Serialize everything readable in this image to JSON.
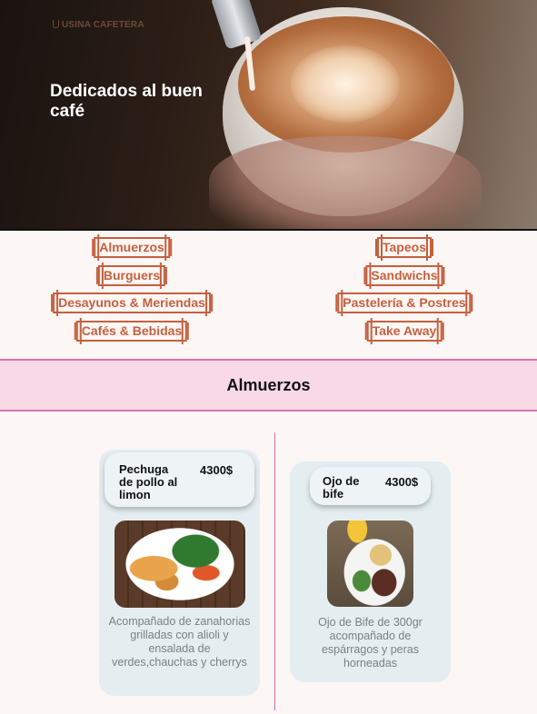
{
  "brand": {
    "logo_text": "USINA CAFETERA"
  },
  "hero": {
    "title": "Dedicados al buen café"
  },
  "menu": {
    "left": [
      "Almuerzos",
      "Burguers",
      "Desayunos & Meriendas",
      "Cafés & Bebidas"
    ],
    "right": [
      "Tapeos",
      "Sandwichs",
      "Pastelería & Postres",
      "Take Away"
    ]
  },
  "section": {
    "title": "Almuerzos"
  },
  "items": [
    {
      "name": "Pechuga de pollo al limon",
      "price": "4300$",
      "description": "Acompañado de zanahorias grilladas con alioli y ensalada de verdes,chauchas y cherrys",
      "image_icon": "chicken-salad-plate-image"
    },
    {
      "name": "Ojo de bife",
      "price": "4300$",
      "description": "Ojo de Bife de 300gr acompañado de espárragos y peras horneadas",
      "image_icon": "steak-plate-image"
    }
  ],
  "colors": {
    "accent": "#c4603f",
    "section_bg": "#f9d9e6",
    "section_border": "#d773a8",
    "card_bg": "#e4eef1"
  }
}
